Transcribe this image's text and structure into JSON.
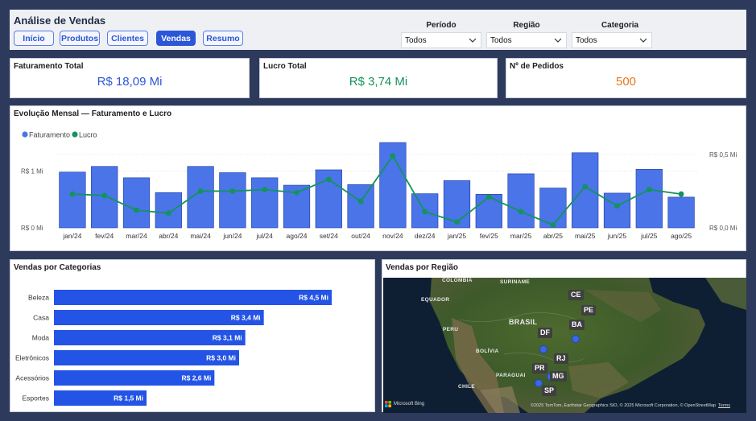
{
  "header": {
    "title": "Análise de Vendas",
    "nav": [
      "Início",
      "Produtos",
      "Clientes",
      "Vendas",
      "Resumo"
    ],
    "active_nav": "Vendas",
    "filters": [
      {
        "label": "Período",
        "value": "Todos"
      },
      {
        "label": "Região",
        "value": "Todos"
      },
      {
        "label": "Categoria",
        "value": "Todos"
      }
    ]
  },
  "kpis": [
    {
      "label": "Faturamento Total",
      "value": "R$ 18,09 Mi",
      "color": "#2c56d8"
    },
    {
      "label": "Lucro Total",
      "value": "R$ 3,74 Mi",
      "color": "#15935a"
    },
    {
      "label": "Nº de Pedidos",
      "value": "500",
      "color": "#e8761c"
    }
  ],
  "chart_data": [
    {
      "type": "bar",
      "title": "Evolução Mensal — Faturamento e Lucro",
      "categories": [
        "jan/24",
        "fev/24",
        "mar/24",
        "abr/24",
        "mai/24",
        "jun/24",
        "jul/24",
        "ago/24",
        "set/24",
        "out/24",
        "nov/24",
        "dez/24",
        "jan/25",
        "fev/25",
        "mar/25",
        "abr/25",
        "mai/25",
        "jun/25",
        "jul/25",
        "ago/25"
      ],
      "series": [
        {
          "name": "Faturamento",
          "type": "bar",
          "axis": "left",
          "color": "#4a74e8",
          "values": [
            0.98,
            1.08,
            0.88,
            0.62,
            1.08,
            0.97,
            0.88,
            0.75,
            1.02,
            0.76,
            1.5,
            0.6,
            0.83,
            0.59,
            0.95,
            0.7,
            1.32,
            0.61,
            1.03,
            0.54
          ]
        },
        {
          "name": "Lucro",
          "type": "line",
          "axis": "right",
          "color": "#14935c",
          "values": [
            0.23,
            0.22,
            0.12,
            0.1,
            0.25,
            0.25,
            0.26,
            0.24,
            0.33,
            0.18,
            0.49,
            0.11,
            0.04,
            0.21,
            0.11,
            0.02,
            0.28,
            0.15,
            0.26,
            0.23
          ]
        }
      ],
      "left_ticks": [
        "R$ 0 Mi",
        "R$ 1 Mi"
      ],
      "left_tick_values": [
        0,
        1
      ],
      "ylim_left": [
        0,
        1.6
      ],
      "right_ticks": [
        "R$ 0,0 Mi",
        "R$ 0,5 Mi"
      ],
      "right_tick_values": [
        0,
        0.5
      ],
      "ylim_right": [
        0,
        0.62
      ],
      "legend": "top-left",
      "grid": true
    },
    {
      "type": "bar",
      "orientation": "horizontal",
      "title": "Vendas por Categorias",
      "categories": [
        "Beleza",
        "Casa",
        "Moda",
        "Eletrônicos",
        "Acessórios",
        "Esportes"
      ],
      "values": [
        4.5,
        3.4,
        3.1,
        3.0,
        2.6,
        1.5
      ],
      "labels": [
        "R$ 4,5 Mi",
        "R$ 3,4 Mi",
        "R$ 3,1 Mi",
        "R$ 3,0 Mi",
        "R$ 2,6 Mi",
        "R$ 1,5 Mi"
      ],
      "xlim": [
        0,
        4.8
      ],
      "color": "#2454e6"
    }
  ],
  "map": {
    "title": "Vendas por Região",
    "countries": [
      "COLÔMBIA",
      "SURINAME",
      "EQUADOR",
      "PERU",
      "BRASIL",
      "BOLÍVIA",
      "PARAGUAI",
      "CHILE"
    ],
    "states": [
      "CE",
      "PE",
      "BA",
      "DF",
      "RJ",
      "PR",
      "MG",
      "SP"
    ],
    "logo": "Microsoft Bing",
    "attribution": "©2025 TomTom, Earthstar Geographics SIO, © 2025 Microsoft Corporation, © OpenStreetMap",
    "terms": "Terms"
  },
  "colors": {
    "background": "#2d3a5c",
    "accent": "#2c56d8"
  }
}
